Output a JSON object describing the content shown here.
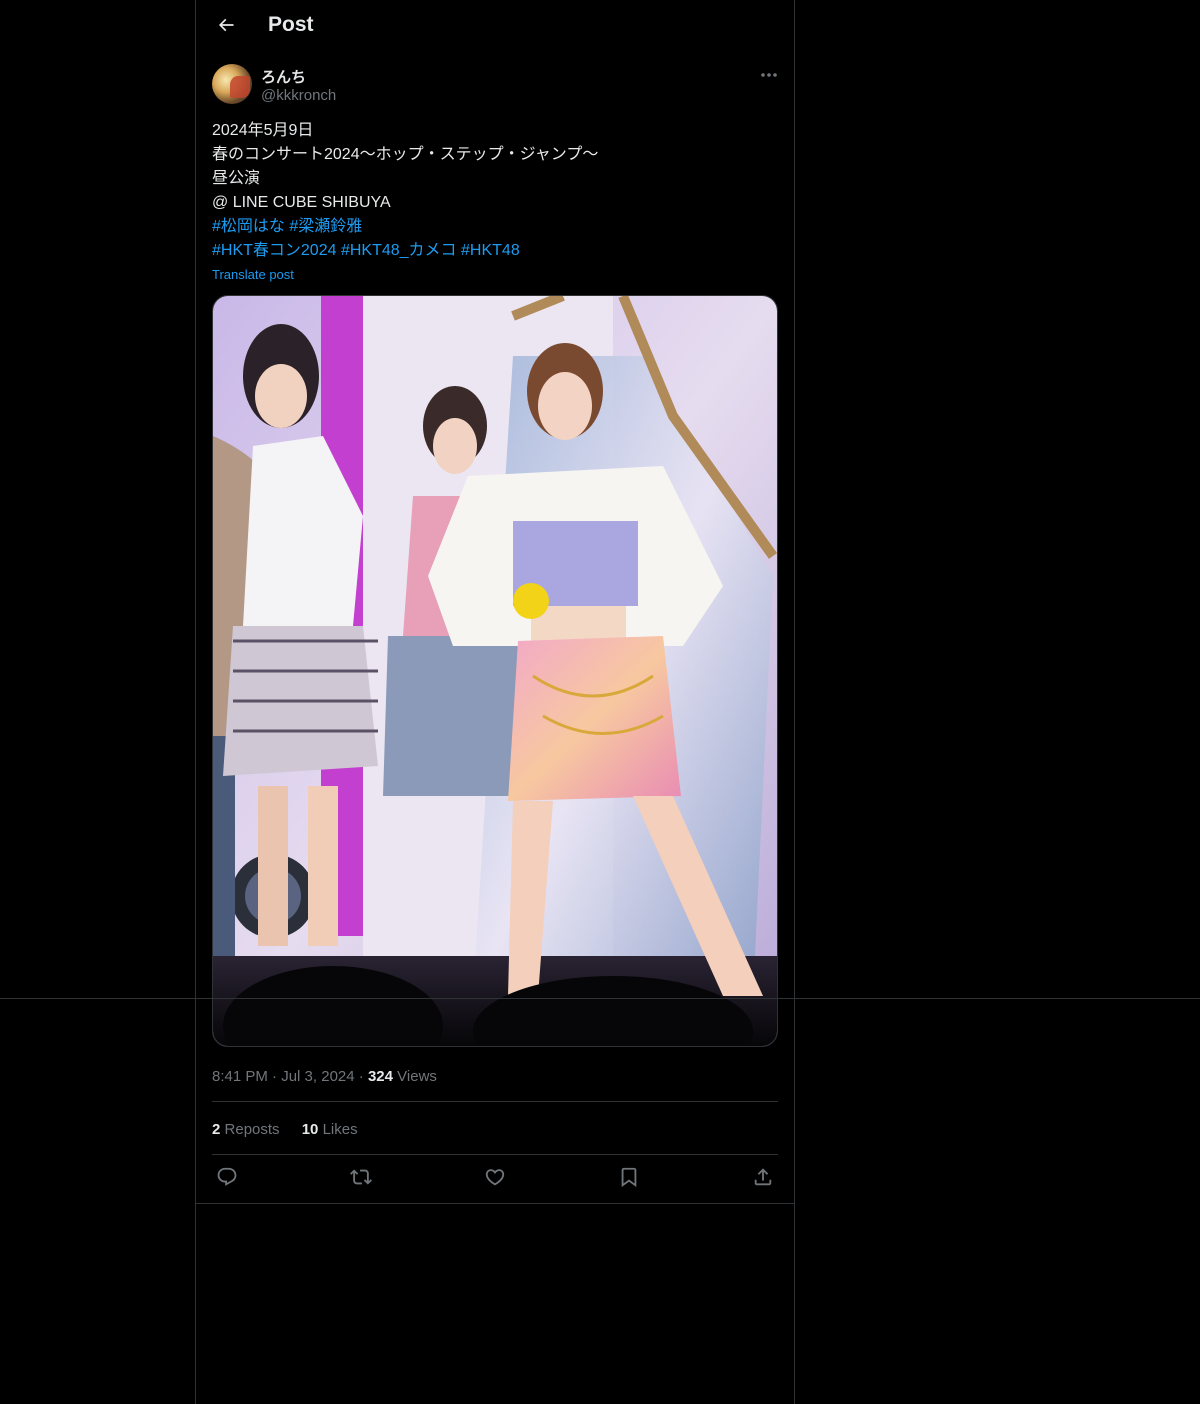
{
  "header": {
    "title": "Post",
    "back_icon": "arrow-left-icon"
  },
  "author": {
    "display_name": "ろんち",
    "handle": "@kkkronch"
  },
  "tweet": {
    "lines": [
      "2024年5月9日",
      "春のコンサート2024〜ホップ・ステップ・ジャンプ〜",
      "昼公演",
      "@ LINE CUBE SHIBUYA"
    ],
    "hashtags_line1": [
      "#松岡はな",
      "#梁瀬鈴雅"
    ],
    "hashtags_line2": [
      "#HKT春コン2024",
      "#HKT48_カメコ",
      "#HKT48"
    ],
    "translate_label": "Translate post"
  },
  "meta": {
    "time": "8:41 PM",
    "date": "Jul 3, 2024",
    "separator": "·",
    "views_count": "324",
    "views_label": "Views"
  },
  "stats": {
    "reposts_count": "2",
    "reposts_label": "Reposts",
    "likes_count": "10",
    "likes_label": "Likes"
  },
  "actions": [
    "reply-icon",
    "repost-icon",
    "like-icon",
    "bookmark-icon",
    "share-icon"
  ],
  "colors": {
    "background": "#000000",
    "text": "#e7e9ea",
    "muted": "#71767b",
    "link": "#1d9bf0",
    "border": "#2f3336"
  }
}
